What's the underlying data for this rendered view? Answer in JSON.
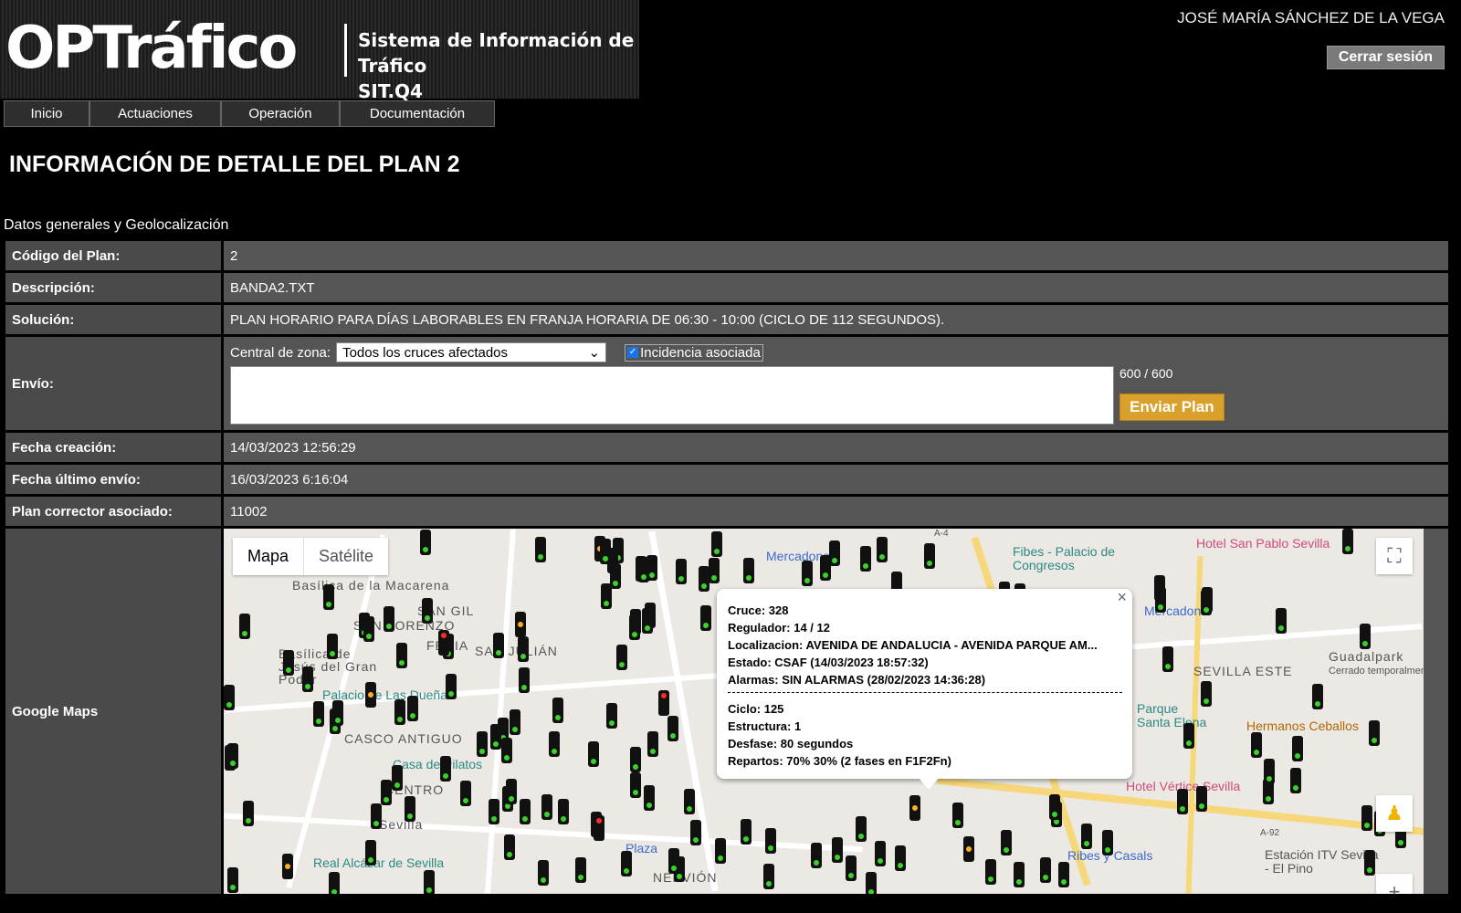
{
  "header": {
    "logo": "OPTráfico",
    "subtitle_line1": "Sistema de Información de Tráfico",
    "subtitle_line2": "SIT.Q4",
    "user_name": "JOSÉ MARÍA SÁNCHEZ DE LA VEGA",
    "logout_label": "Cerrar sesión"
  },
  "nav": [
    "Inicio",
    "Actuaciones",
    "Operación",
    "Documentación"
  ],
  "page_title": "INFORMACIÓN DE DETALLE DEL PLAN 2",
  "section_title": "Datos generales y Geolocalización",
  "fields": {
    "codigo_label": "Código del Plan:",
    "codigo_value": "2",
    "descripcion_label": "Descripción:",
    "descripcion_value": "BANDA2.TXT",
    "solucion_label": "Solución:",
    "solucion_value": "PLAN HORARIO PARA DÍAS LABORABLES EN FRANJA HORARIA DE 06:30 - 10:00 (CICLO DE 112 SEGUNDOS).",
    "envio_label": "Envío:",
    "central_label": "Central de zona:",
    "central_selected": "Todos los cruces afectados",
    "incidencia_label": "Incidencia asociada",
    "incidencia_checked": true,
    "counter": "600 / 600",
    "send_label": "Enviar Plan",
    "fecha_creacion_label": "Fecha creación:",
    "fecha_creacion_value": "14/03/2023 12:56:29",
    "fecha_envio_label": "Fecha último envío:",
    "fecha_envio_value": "16/03/2023 6:16:04",
    "corrector_label": "Plan corrector asociado:",
    "corrector_value": "11002",
    "maps_label": "Google Maps"
  },
  "map": {
    "type_map": "Mapa",
    "type_satellite": "Satélite",
    "labels": [
      "Basílica de la Macarena",
      "SAN GIL",
      "SAN LORENZO",
      "FERIA",
      "SAN JULIÁN",
      "Basílica de Jesús del Gran Poder",
      "Palacio de Las Dueñas",
      "CASCO ANTIGUO",
      "Casa de Pilatos",
      "CENTRO",
      "Sevilla",
      "Real Alcázar de Sevilla",
      "Plaza",
      "NERVIÓN",
      "Mercadona",
      "Fibes - Palacio de Congresos",
      "Hotel San Pablo Sevilla",
      "Mercadona",
      "SEVILLA ESTE",
      "Guadalpark",
      "Cerrado temporalmente",
      "Parque Santa Elena",
      "Hermanos Ceballos",
      "Hotel Vértice Sevilla",
      "Ribes y Casals",
      "Estación ITV Sevilla - El Pino",
      "A-92",
      "A-4"
    ],
    "info": {
      "cruce": "Cruce: 328",
      "regulador": "Regulador: 14 / 12",
      "localizacion": "Localizacion: AVENIDA DE ANDALUCIA - AVENIDA PARQUE AM...",
      "estado": "Estado: CSAF (14/03/2023 18:57:32)",
      "alarmas": "Alarmas: SIN ALARMAS (28/02/2023 14:36:28)",
      "ciclo": "Ciclo: 125",
      "estructura": "Estructura: 1",
      "desfase": "Desfase: 80 segundos",
      "repartos": "Repartos: 70% 30% (2 fases en F1F2Fn)"
    },
    "icons": {
      "fullscreen": "fullscreen-icon",
      "pegman": "pegman-icon",
      "zoom_in": "zoom-in-icon",
      "close": "close-icon"
    }
  }
}
